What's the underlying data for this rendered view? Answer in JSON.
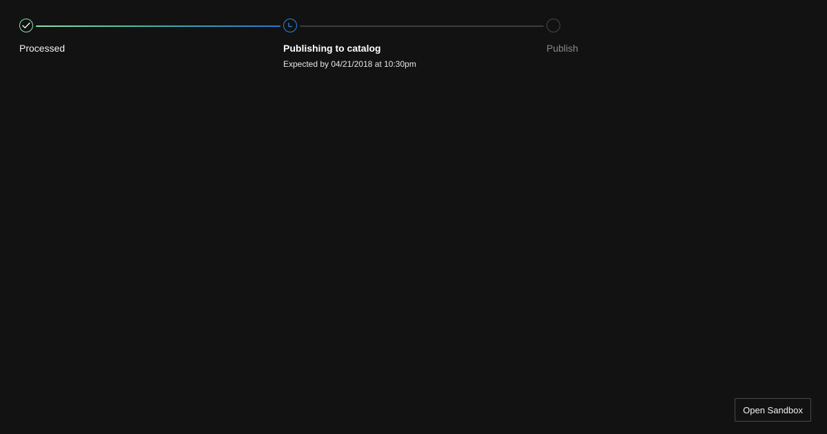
{
  "progress": {
    "steps": [
      {
        "label": "Processed",
        "status": "complete",
        "icon": "check-icon"
      },
      {
        "label": "Publishing to catalog",
        "status": "in-progress",
        "icon": "clock-icon",
        "detail": "Expected by 04/21/2018 at 10:30pm"
      },
      {
        "label": "Publish",
        "status": "pending",
        "icon": "empty-circle-icon"
      }
    ]
  },
  "colors": {
    "background": "#121212",
    "complete": "#8fe3b0",
    "active": "#2f86e0",
    "pending": "#4a4a4a"
  },
  "actions": {
    "open_sandbox_label": "Open Sandbox"
  }
}
